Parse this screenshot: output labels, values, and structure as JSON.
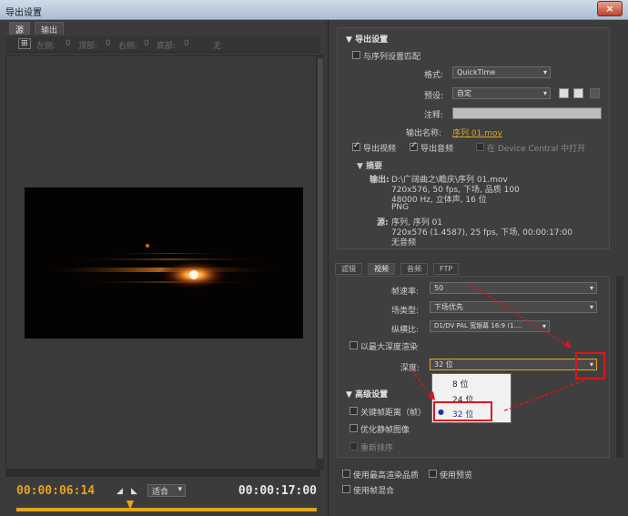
{
  "window": {
    "title": "导出设置",
    "close_label": "×"
  },
  "left": {
    "tabs": [
      "源",
      "输出"
    ],
    "tools": [
      "⊞",
      "左侧:",
      "0",
      "顶部:",
      "0",
      "右侧:",
      "0",
      "底部:",
      "0",
      "无"
    ],
    "timecode_current": "00:00:06:14",
    "timecode_end": "00:00:17:00",
    "fit_label": "适合"
  },
  "export": {
    "heading": "导出设置",
    "match_sequence": "与序列设置匹配",
    "format_label": "格式:",
    "format_value": "QuickTime",
    "preset_label": "预设:",
    "preset_value": "自定",
    "comment_label": "注释:",
    "comment_value": "",
    "output_name_label": "输出名称:",
    "output_name_value": "序列 01.mov",
    "export_video": "导出视频",
    "export_audio": "导出音频",
    "device_central": "在 Device Central 中打开",
    "summary_heading": "摘要",
    "output_label": "输出:",
    "output_lines": [
      "D:\\广阔曲之\\瞻庆\\序列 01.mov",
      "720x576, 50 fps, 下场, 品质 100",
      "48000 Hz, 立体声, 16 位",
      "PNG"
    ],
    "source_label": "源:",
    "source_lines": [
      "序列, 序列 01",
      "720x576 (1.4587), 25 fps, 下场, 00:00:17:00",
      "无音频"
    ]
  },
  "tabs": [
    "滤镜",
    "视频",
    "音频",
    "FTP"
  ],
  "video": {
    "framerate_label": "帧速率:",
    "framerate_value": "50",
    "fieldtype_label": "场类型:",
    "fieldtype_value": "下场优先",
    "aspect_label": "纵横比:",
    "aspect_value": "D1/DV PAL 宽银幕 16:9 (1....",
    "maxdepth_label": "以最大深度渲染",
    "depth_label": "深度:",
    "depth_value": "32 位",
    "depth_options": [
      "8 位",
      "24 位",
      "32 位"
    ],
    "advanced_heading": "高级设置",
    "keyframe_label": "关键帧距离（帧）",
    "optimize_label": "优化静帧图像",
    "frame_reorder": "重新排序"
  },
  "footer": {
    "max_quality": "使用最高渲染品质",
    "use_preview": "使用预览",
    "frame_blend": "使用帧混合"
  },
  "colors": {
    "accent": "#e3a520",
    "highlight": "#e0141b"
  }
}
